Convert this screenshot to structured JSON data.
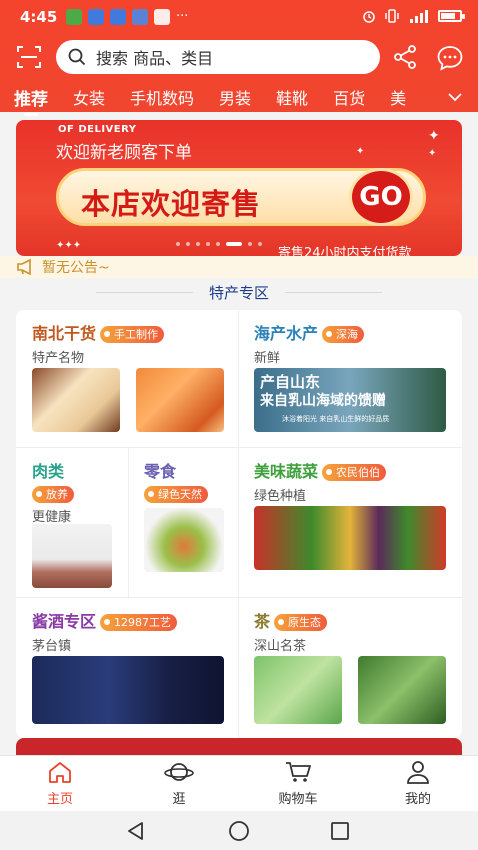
{
  "status": {
    "time": "4:45",
    "more": "···"
  },
  "search": {
    "placeholder": "搜索 商品、类目"
  },
  "tabs": [
    "推荐",
    "女装",
    "手机数码",
    "男装",
    "鞋靴",
    "百货",
    "美"
  ],
  "banner": {
    "top_text": "OF DELIVERY",
    "welcome": "欢迎新老顾客下单",
    "main": "本店欢迎寄售",
    "go": "GO",
    "bottom": "寄售24小时内支付货款"
  },
  "notice": {
    "text": "暂无公告~"
  },
  "section": {
    "title": "特产专区"
  },
  "categories": {
    "c1": {
      "title": "南北干货",
      "tag": "手工制作",
      "sub": "特产名物",
      "color": "#c1581f"
    },
    "c2": {
      "title": "海产水产",
      "tag": "深海",
      "sub": "新鲜",
      "color": "#2b82b8",
      "img_text_1": "产自山东",
      "img_text_2": "来自乳山海域的馈赠",
      "img_text_3": "沐浴着阳光 来自乳山生鲜的好品质"
    },
    "c3": {
      "title": "肉类",
      "tag": "放养",
      "sub": "更健康",
      "color": "#2aa18c"
    },
    "c4": {
      "title": "零食",
      "tag": "绿色天然",
      "sub": "",
      "color": "#6b5fb2"
    },
    "c5": {
      "title": "美味蔬菜",
      "tag": "农民伯伯",
      "sub": "绿色种植",
      "color": "#3ea03a"
    },
    "c6": {
      "title": "酱酒专区",
      "tag": "12987工艺",
      "sub": "茅台镇",
      "color": "#8a3aa6"
    },
    "c7": {
      "title": "茶",
      "tag": "原生态",
      "sub": "深山名茶",
      "color": "#8a7a2c"
    }
  },
  "bottom_nav": {
    "home": "主页",
    "browse": "逛",
    "cart": "购物车",
    "mine": "我的"
  },
  "colors": {
    "brand": "#f0452f",
    "active": "#e8442b"
  }
}
